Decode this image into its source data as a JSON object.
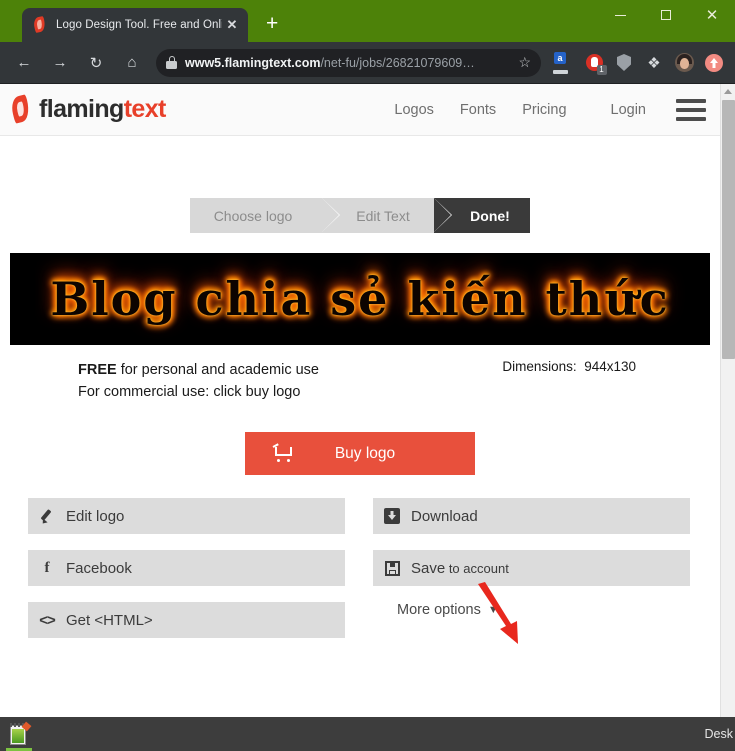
{
  "browser": {
    "tab": {
      "title": "Logo Design Tool. Free and Onlin",
      "close_label": "✕",
      "favicon_name": "flamingtext-flame-favicon"
    },
    "new_tab_label": "+",
    "window_controls": {
      "minimize": "–",
      "maximize": "□",
      "close": "✕"
    },
    "nav": {
      "back": "←",
      "forward": "→",
      "reload": "↻",
      "home": "⌂"
    },
    "omnibox": {
      "url_domain": "www5.flamingtext.com",
      "url_path": "/net-fu/jobs/26821079609…",
      "bookmark_star": "☆",
      "lock_icon": "site-secure-lock"
    },
    "extensions": [
      {
        "name": "google-translate-extension-icon",
        "badge": "a"
      },
      {
        "name": "red-hand-extension-icon",
        "badge": "1"
      },
      {
        "name": "shield-extension-icon",
        "badge": ""
      },
      {
        "name": "puzzle-extensions-icon",
        "badge": "❖"
      },
      {
        "name": "profile-avatar",
        "badge": ""
      },
      {
        "name": "pink-upload-extension-icon",
        "badge": ""
      }
    ]
  },
  "site": {
    "brand": {
      "part_a": "flaming",
      "part_b": "text",
      "flame_icon": "flamingtext-flame-logo"
    },
    "nav": [
      {
        "label": "Logos"
      },
      {
        "label": "Fonts"
      },
      {
        "label": "Pricing"
      },
      {
        "label": "Login"
      }
    ],
    "menu_icon": "hamburger-menu-icon"
  },
  "steps": [
    {
      "label": "Choose logo",
      "active": false
    },
    {
      "label": "Edit Text",
      "active": false
    },
    {
      "label": "Done!",
      "active": true
    }
  ],
  "preview": {
    "logo_text": "Blog chia sẻ kiến thức",
    "background": "#000000",
    "flame_color": "#ff7a00"
  },
  "license": {
    "line1_strong": "FREE",
    "line1_rest": " for personal and academic use",
    "line2": "For commercial use: click buy logo",
    "dimensions_label": "Dimensions:",
    "dimensions_value": "944x130"
  },
  "buy": {
    "label": "Buy logo",
    "icon": "shopping-cart-icon",
    "color": "#e8503c"
  },
  "actions": {
    "left": [
      {
        "label": "Edit logo",
        "icon": "pencil-icon"
      },
      {
        "label": "Facebook",
        "icon": "facebook-f-icon"
      },
      {
        "label": "Get <HTML>",
        "icon": "code-brackets-icon"
      }
    ],
    "right": [
      {
        "label": "Download",
        "icon": "download-box-icon"
      },
      {
        "label_strong": "Save",
        "label_small": " to account",
        "icon": "floppy-disk-icon"
      }
    ],
    "more_options": {
      "label": "More options",
      "caret": "▼"
    }
  },
  "annotation": {
    "name": "red-arrow-pointing-to-download",
    "color": "#e8281e"
  },
  "taskbar": {
    "item_icon": "notepad-app-icon",
    "right_label": "Desk"
  },
  "scrollbar": {
    "up_arrow": "▲"
  }
}
